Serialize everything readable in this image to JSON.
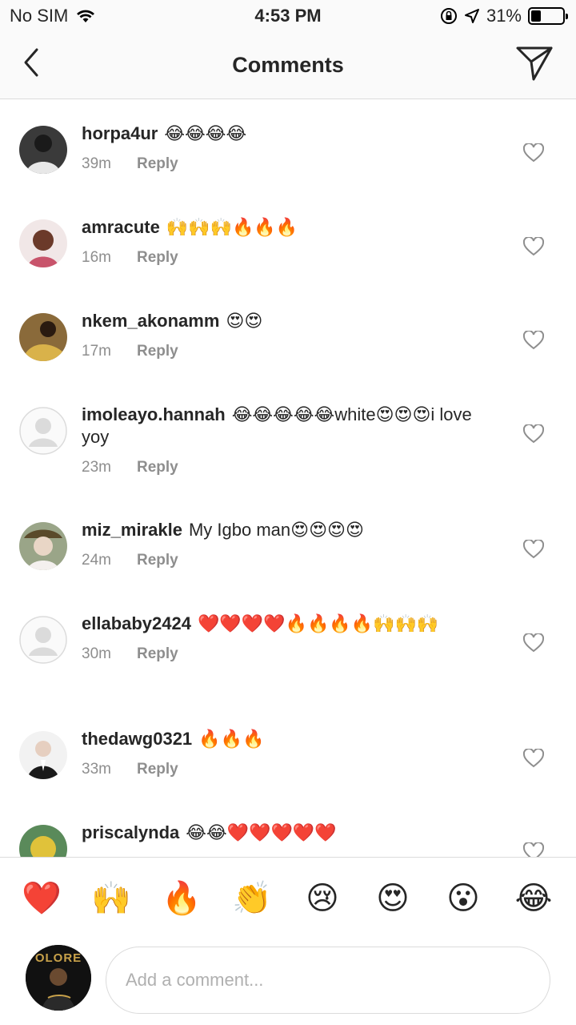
{
  "status_bar": {
    "carrier": "No SIM",
    "time": "4:53 PM",
    "battery": "31%",
    "battery_level": 0.31
  },
  "header": {
    "title": "Comments",
    "back_icon": "chevron-left-icon",
    "send_icon": "paper-plane-icon"
  },
  "comments": [
    {
      "username": "horpa4ur",
      "text": "😂😂😂😂",
      "time": "39m",
      "reply": "Reply"
    },
    {
      "username": "amracute",
      "text": "🙌🙌🙌🔥🔥🔥",
      "time": "16m",
      "reply": "Reply"
    },
    {
      "username": "nkem_akonamm",
      "text": "😍😍",
      "time": "17m",
      "reply": "Reply"
    },
    {
      "username": "imoleayo.hannah",
      "text": "😂😂😂😂😂white😍😍😍i love yoy",
      "time": "23m",
      "reply": "Reply"
    },
    {
      "username": "miz_mirakle",
      "text": "My Igbo man😍😍😍😍",
      "time": "24m",
      "reply": "Reply"
    },
    {
      "username": "ellababy2424",
      "text": "❤️❤️❤️❤️🔥🔥🔥🔥🙌🙌🙌",
      "time": "30m",
      "reply": "Reply"
    },
    {
      "username": "thedawg0321",
      "text": "🔥🔥🔥",
      "time": "33m",
      "reply": "Reply"
    },
    {
      "username": "priscalynda",
      "text": "😂😂❤️❤️❤️❤️❤️",
      "time": "",
      "reply": ""
    }
  ],
  "reactions": [
    "❤️",
    "🙌",
    "🔥",
    "👏",
    "😢",
    "😍",
    "😮",
    "😂"
  ],
  "composer": {
    "placeholder": "Add a comment...",
    "avatar_text": "OLORE"
  },
  "colors": {
    "text": "#262626",
    "meta": "#8e8e8e",
    "border": "#dbdbdb",
    "header_bg": "#fafafa"
  }
}
